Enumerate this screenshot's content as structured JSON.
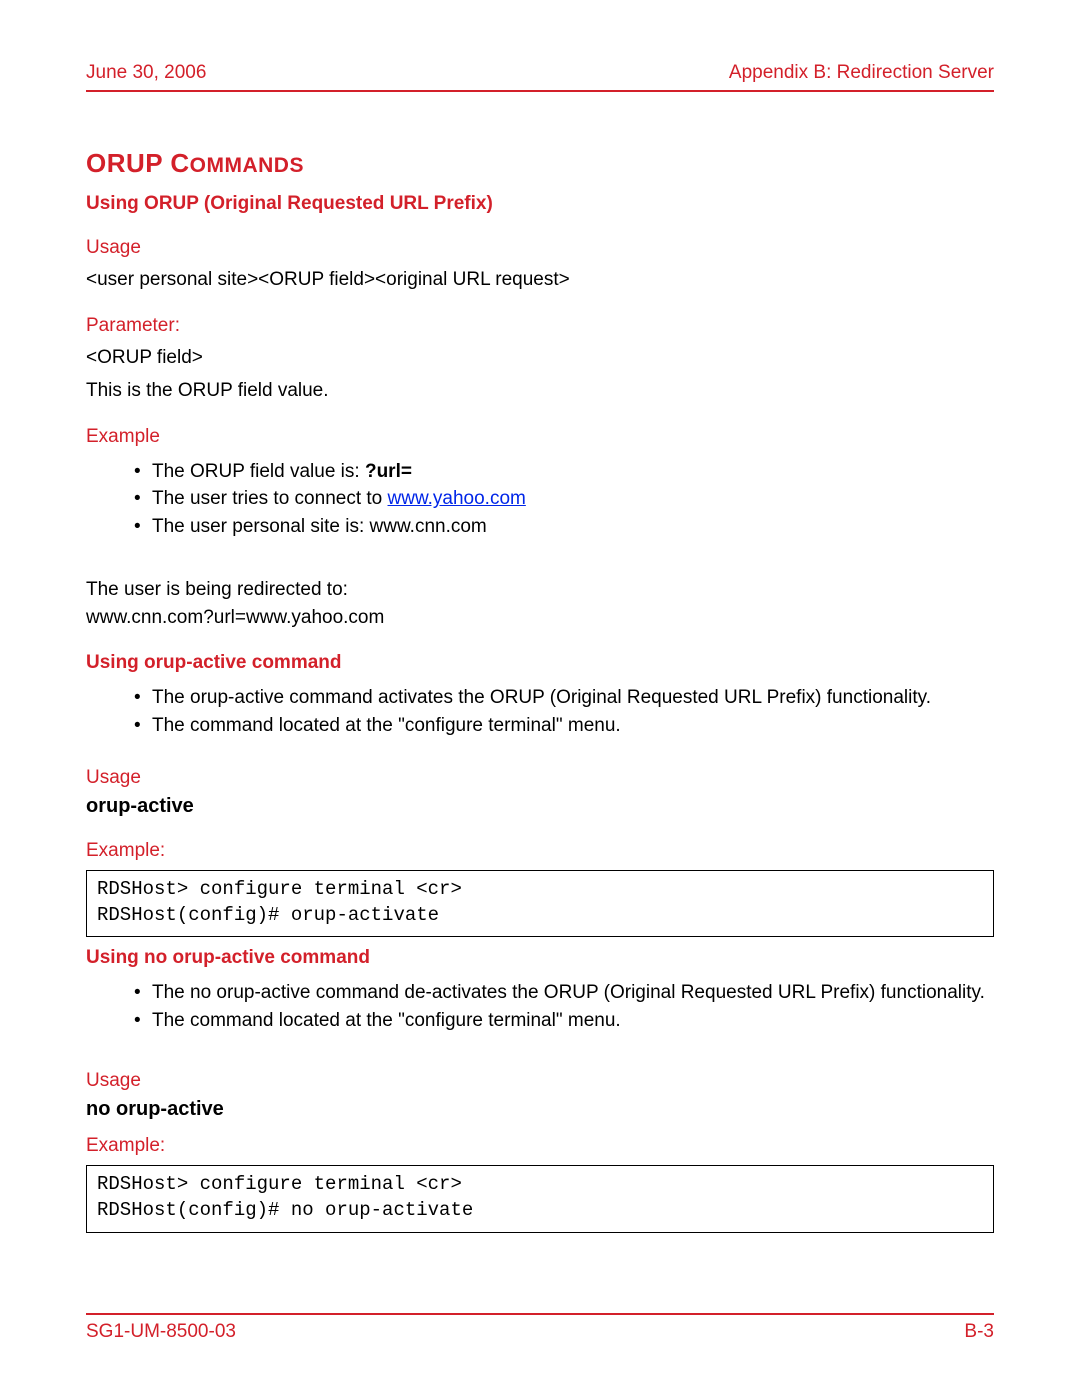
{
  "header": {
    "date": "June 30, 2006",
    "appendix": "Appendix B: Redirection Server"
  },
  "title": {
    "main": "ORUP C",
    "rest": "OMMANDS"
  },
  "s1": {
    "heading": "Using ORUP (Original Requested URL Prefix)",
    "usage_label": "Usage",
    "usage_text": "<user personal site><ORUP field><original URL request>",
    "param_label": "Parameter:",
    "param_name": "<ORUP field>",
    "param_desc": "This is the ORUP field value.",
    "example_label": "Example",
    "ex_b1_a": "The ORUP field value is: ",
    "ex_b1_b": "?url=",
    "ex_b2_a": "The user tries to connect to ",
    "ex_b2_link": "www.yahoo.com",
    "ex_b3": "The user personal site is: www.cnn.com",
    "redir1": "The user is being redirected to:",
    "redir2": "www.cnn.com?url=www.yahoo.com"
  },
  "s2": {
    "heading": "Using orup-active command",
    "b1": "The orup-active command activates the ORUP (Original Requested URL Prefix) functionality.",
    "b2": "The command located at the \"configure terminal\" menu.",
    "usage_label": "Usage",
    "cmd_name": "orup-active",
    "example_label": "Example:",
    "code": "RDSHost> configure terminal <cr>\nRDSHost(config)# orup-activate"
  },
  "s3": {
    "heading": "Using no orup-active command",
    "b1": "The no orup-active command de-activates the ORUP (Original Requested URL Prefix) functionality.",
    "b2": "The command located at the \"configure terminal\" menu.",
    "usage_label": "Usage",
    "cmd_name": "no orup-active",
    "example_label": "Example:",
    "code": "RDSHost> configure terminal <cr>\nRDSHost(config)# no orup-activate"
  },
  "footer": {
    "doc": "SG1-UM-8500-03",
    "page": "B-3"
  }
}
